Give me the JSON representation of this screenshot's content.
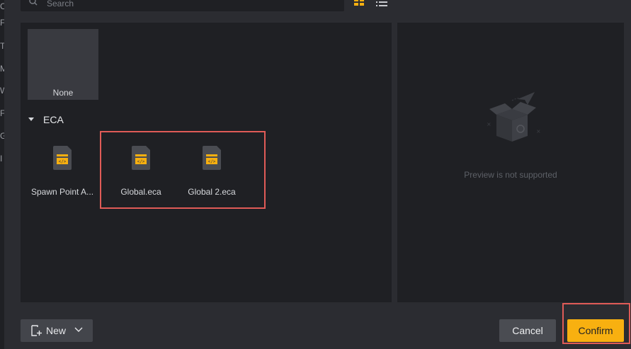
{
  "search": {
    "placeholder": "Search"
  },
  "left_strip": {
    "letters": [
      "C",
      "F",
      "T",
      "M",
      "W",
      "F",
      "G",
      "I"
    ]
  },
  "view_toggle": {
    "active": "grid",
    "accent": "#f8b010"
  },
  "assets": {
    "none_tile": {
      "label": "None"
    },
    "section": {
      "label": "ECA",
      "expanded": true
    },
    "files": [
      {
        "label": "Spawn Point A..."
      },
      {
        "label": "Global.eca"
      },
      {
        "label": "Global 2.eca"
      }
    ]
  },
  "preview": {
    "message": "Preview is not supported"
  },
  "footer": {
    "new_label": "New",
    "cancel_label": "Cancel",
    "confirm_label": "Confirm"
  },
  "colors": {
    "background": "#2b2c31",
    "panel": "#1f2024",
    "accent": "#f8b010",
    "highlight": "#e05b57"
  }
}
